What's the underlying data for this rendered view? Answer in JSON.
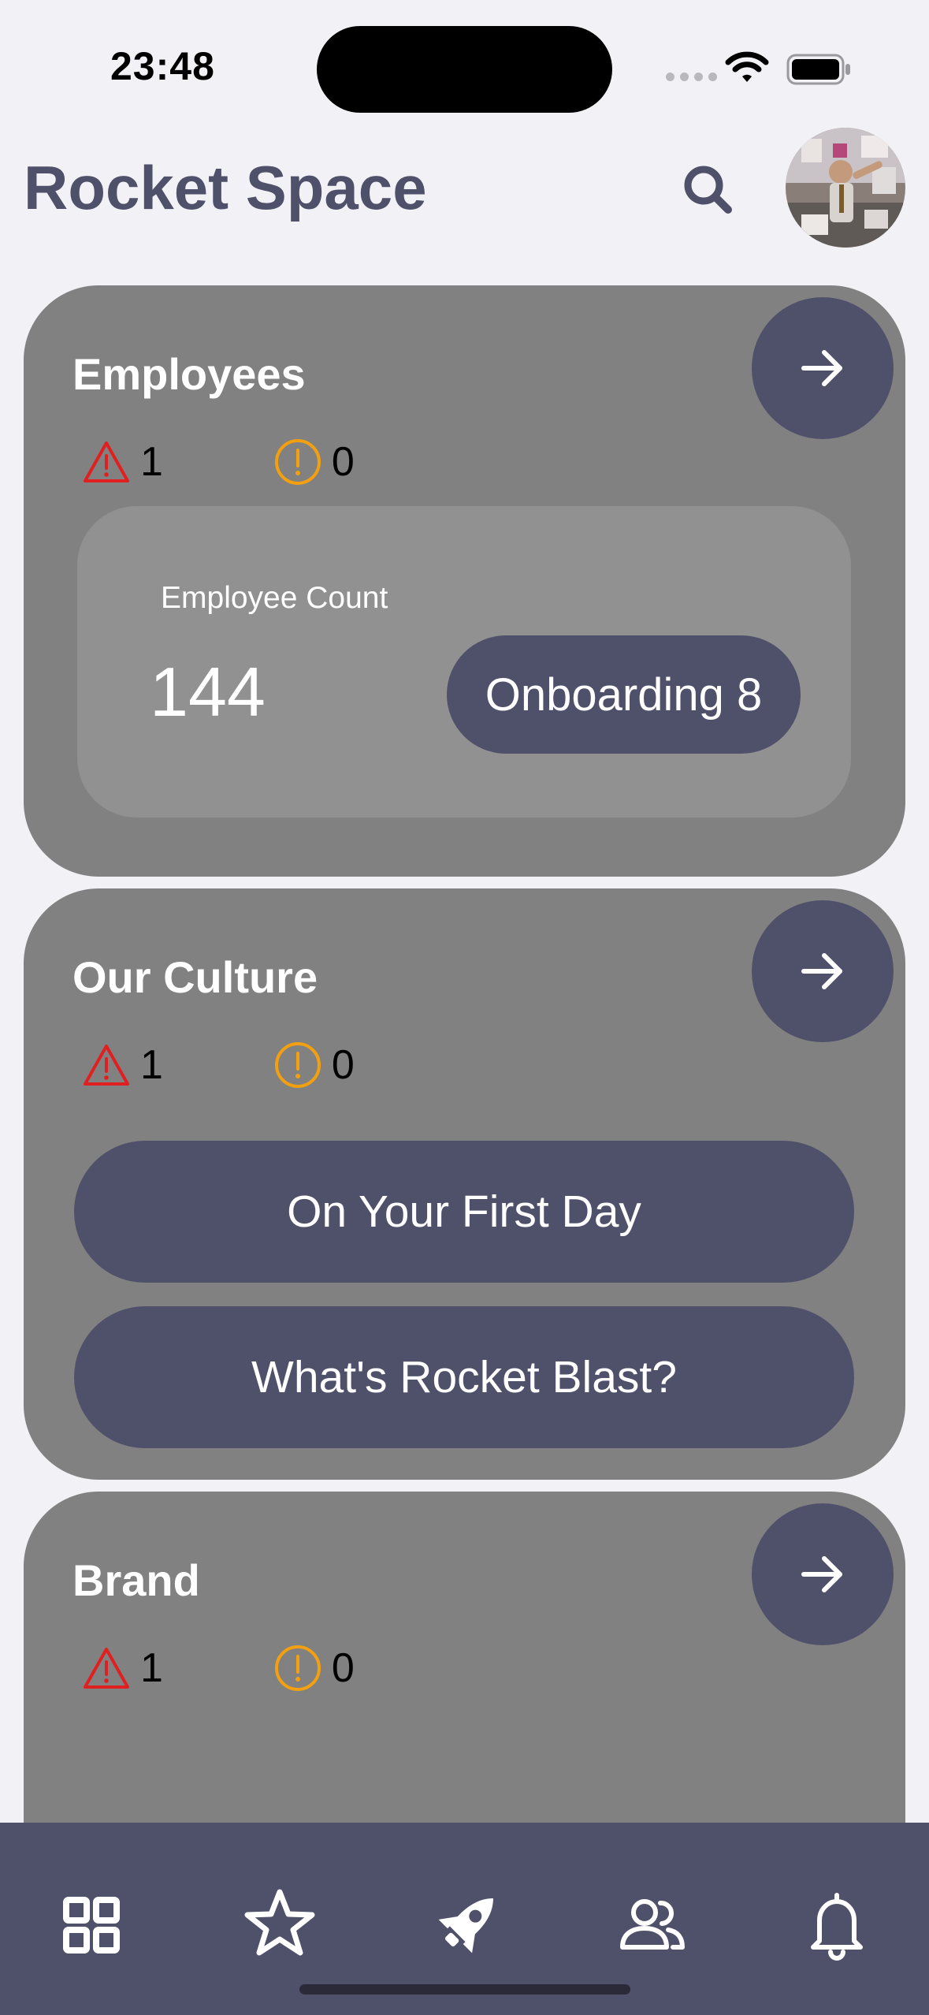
{
  "status_bar": {
    "time": "23:48"
  },
  "header": {
    "title": "Rocket Space"
  },
  "cards": [
    {
      "title": "Employees",
      "alerts": {
        "errors": "1",
        "warnings": "0"
      },
      "panel": {
        "label": "Employee Count",
        "count": "144",
        "onboarding_label": "Onboarding 8"
      }
    },
    {
      "title": "Our Culture",
      "alerts": {
        "errors": "1",
        "warnings": "0"
      },
      "buttons": [
        "On Your First Day",
        "What's Rocket Blast?"
      ]
    },
    {
      "title": "Brand",
      "alerts": {
        "errors": "1",
        "warnings": "0"
      }
    }
  ],
  "bottom_nav": {
    "items": [
      {
        "icon": "grid-icon"
      },
      {
        "icon": "star-icon"
      },
      {
        "icon": "rocket-icon"
      },
      {
        "icon": "people-icon"
      },
      {
        "icon": "bell-icon"
      }
    ]
  },
  "colors": {
    "accent": "#4f5069",
    "card": "#818181",
    "panel": "#919191",
    "error": "#e02020",
    "warning": "#f2a011",
    "background": "#f2f2f6"
  }
}
